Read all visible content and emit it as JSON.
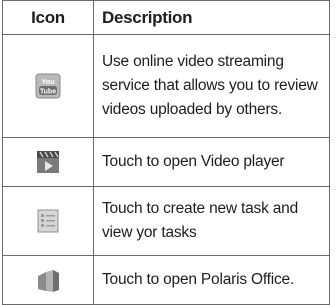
{
  "table": {
    "headers": {
      "icon": "Icon",
      "description": "Description"
    },
    "rows": [
      {
        "icon": "youtube-icon",
        "icon_text_top": "You",
        "icon_text_bottom": "Tube",
        "description": "Use online video streaming service that allows you to review videos uploaded by others."
      },
      {
        "icon": "video-player-icon",
        "description": "Touch to open Video player"
      },
      {
        "icon": "tasks-icon",
        "description": "Touch to create new task and view yor tasks"
      },
      {
        "icon": "polaris-office-icon",
        "description": "Touch to open Polaris Office."
      }
    ]
  },
  "colors": {
    "border": "#6a6a6a",
    "text": "#1e1e1e",
    "icon_gray": "#9a9a9a"
  }
}
